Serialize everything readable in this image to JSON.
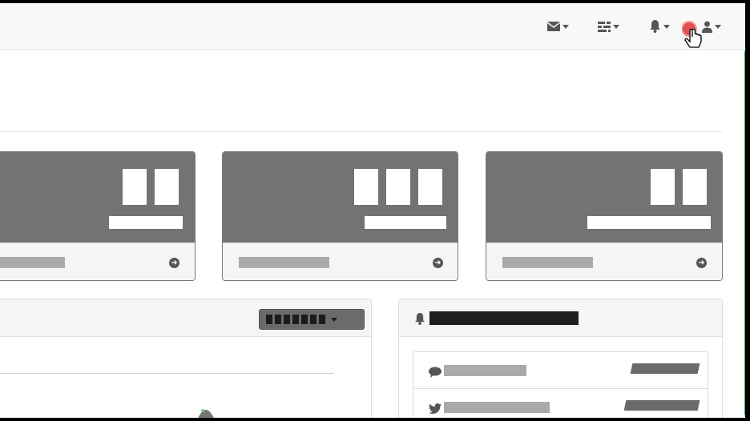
{
  "topbar": {
    "icons": [
      "envelope-icon",
      "tasks-icon",
      "bell-icon",
      "user-icon"
    ]
  },
  "stat_panels": [
    {
      "digits": 2
    },
    {
      "digits": 3
    },
    {
      "digits": 2
    }
  ],
  "chart_panel": {},
  "notifications_panel": {
    "rows": [
      {
        "icon": "comment-icon"
      },
      {
        "icon": "twitter-icon"
      }
    ]
  },
  "colors": {
    "panel_head": "#747374",
    "accent_green": "#2aa84a",
    "record_red": "#e05050"
  }
}
